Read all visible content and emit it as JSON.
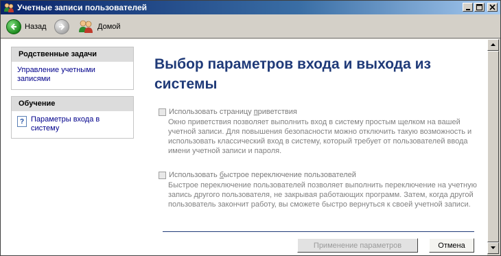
{
  "window": {
    "title": "Учетные записи пользователей"
  },
  "toolbar": {
    "back_label": "Назад",
    "home_label": "Домой"
  },
  "related_tasks": {
    "heading": "Родственные задачи",
    "items": [
      "Управление учетными записями"
    ]
  },
  "learning": {
    "heading": "Обучение",
    "items": [
      "Параметры входа в систему"
    ]
  },
  "main": {
    "heading": "Выбор параметров входа и выхода из системы",
    "options": [
      {
        "title_pre": "Использовать страницу ",
        "title_accel": "п",
        "title_post": "риветствия",
        "description": "Окно приветствия позволяет выполнить вход в систему простым щелком на вашей учетной записи. Для повышения безопасности можно отключить такую возможность и использовать классический вход в систему, который требует от пользователей ввода имени учетной записи и пароля.",
        "checked": false,
        "enabled": false
      },
      {
        "title_pre": "Использовать ",
        "title_accel": "б",
        "title_post": "ыстрое переключение пользователей",
        "description": "Быстрое переключение пользователей позволяет выполнить переключение на учетную запись другого пользователя, не закрывая работающих программ. Затем, когда другой пользователь закончит работу, вы сможете быстро вернуться к своей учетной записи.",
        "checked": false,
        "enabled": false
      }
    ],
    "apply_label": "Применение параметров",
    "cancel_label": "Отмена"
  },
  "colors": {
    "titlebar_start": "#0a246a",
    "heading": "#1f3a78",
    "link": "#00008b"
  }
}
